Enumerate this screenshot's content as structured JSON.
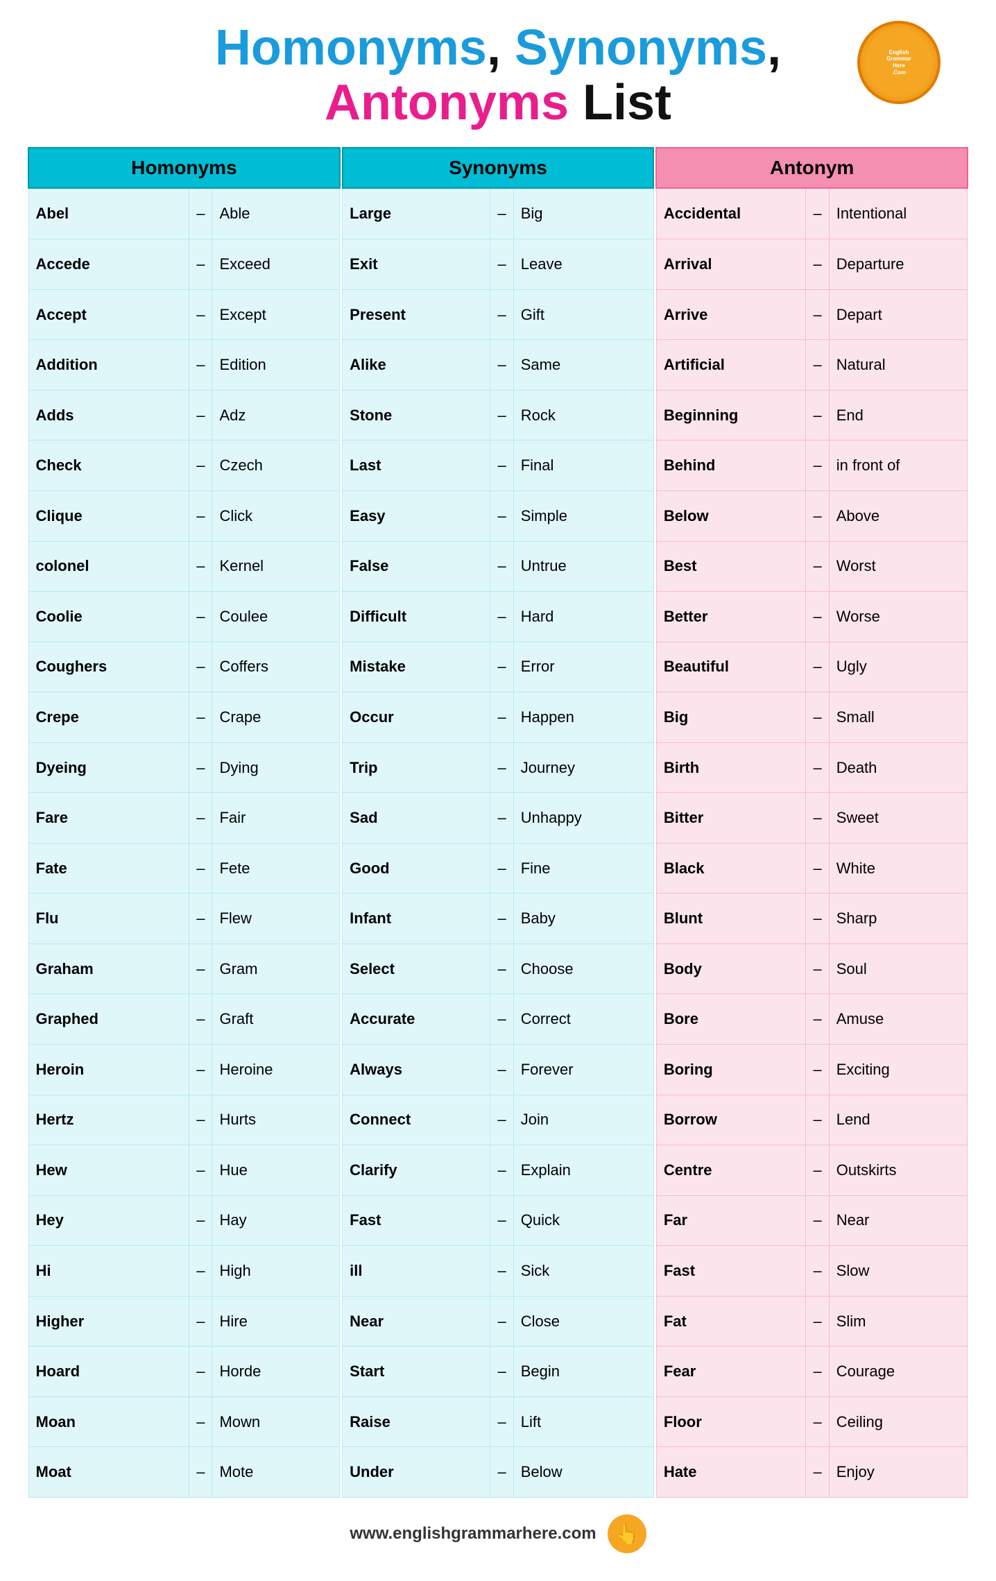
{
  "header": {
    "title_line1": "Homonyms, Synonyms,",
    "title_line2": "Antonyms List"
  },
  "homonyms": {
    "header": "Homonyms",
    "rows": [
      [
        "Abel",
        "Able"
      ],
      [
        "Accede",
        "Exceed"
      ],
      [
        "Accept",
        "Except"
      ],
      [
        "Addition",
        "Edition"
      ],
      [
        "Adds",
        "Adz"
      ],
      [
        "Check",
        "Czech"
      ],
      [
        "Clique",
        "Click"
      ],
      [
        "colonel",
        "Kernel"
      ],
      [
        "Coolie",
        "Coulee"
      ],
      [
        "Coughers",
        "Coffers"
      ],
      [
        "Crepe",
        "Crape"
      ],
      [
        "Dyeing",
        "Dying"
      ],
      [
        "Fare",
        "Fair"
      ],
      [
        "Fate",
        "Fete"
      ],
      [
        "Flu",
        "Flew"
      ],
      [
        "Graham",
        "Gram"
      ],
      [
        "Graphed",
        "Graft"
      ],
      [
        "Heroin",
        "Heroine"
      ],
      [
        "Hertz",
        "Hurts"
      ],
      [
        "Hew",
        "Hue"
      ],
      [
        "Hey",
        "Hay"
      ],
      [
        "Hi",
        "High"
      ],
      [
        "Higher",
        "Hire"
      ],
      [
        "Hoard",
        "Horde"
      ],
      [
        "Moan",
        "Mown"
      ],
      [
        "Moat",
        "Mote"
      ]
    ]
  },
  "synonyms": {
    "header": "Synonyms",
    "rows": [
      [
        "Large",
        "Big"
      ],
      [
        "Exit",
        "Leave"
      ],
      [
        "Present",
        "Gift"
      ],
      [
        "Alike",
        "Same"
      ],
      [
        "Stone",
        "Rock"
      ],
      [
        "Last",
        "Final"
      ],
      [
        "Easy",
        "Simple"
      ],
      [
        "False",
        "Untrue"
      ],
      [
        "Difficult",
        "Hard"
      ],
      [
        "Mistake",
        "Error"
      ],
      [
        "Occur",
        "Happen"
      ],
      [
        "Trip",
        "Journey"
      ],
      [
        "Sad",
        "Unhappy"
      ],
      [
        "Good",
        "Fine"
      ],
      [
        "Infant",
        "Baby"
      ],
      [
        "Select",
        "Choose"
      ],
      [
        "Accurate",
        "Correct"
      ],
      [
        "Always",
        "Forever"
      ],
      [
        "Connect",
        "Join"
      ],
      [
        "Clarify",
        "Explain"
      ],
      [
        "Fast",
        "Quick"
      ],
      [
        "ill",
        "Sick"
      ],
      [
        "Near",
        "Close"
      ],
      [
        "Start",
        "Begin"
      ],
      [
        "Raise",
        "Lift"
      ],
      [
        "Under",
        "Below"
      ]
    ]
  },
  "antonyms": {
    "header": "Antonym",
    "rows": [
      [
        "Accidental",
        "Intentional"
      ],
      [
        "Arrival",
        "Departure"
      ],
      [
        "Arrive",
        "Depart"
      ],
      [
        "Artificial",
        "Natural"
      ],
      [
        "Beginning",
        "End"
      ],
      [
        "Behind",
        "in front of"
      ],
      [
        "Below",
        "Above"
      ],
      [
        "Best",
        "Worst"
      ],
      [
        "Better",
        "Worse"
      ],
      [
        "Beautiful",
        "Ugly"
      ],
      [
        "Big",
        "Small"
      ],
      [
        "Birth",
        "Death"
      ],
      [
        "Bitter",
        "Sweet"
      ],
      [
        "Black",
        "White"
      ],
      [
        "Blunt",
        "Sharp"
      ],
      [
        "Body",
        "Soul"
      ],
      [
        "Bore",
        "Amuse"
      ],
      [
        "Boring",
        "Exciting"
      ],
      [
        "Borrow",
        "Lend"
      ],
      [
        "Centre",
        "Outskirts"
      ],
      [
        "Far",
        "Near"
      ],
      [
        "Fast",
        "Slow"
      ],
      [
        "Fat",
        "Slim"
      ],
      [
        "Fear",
        "Courage"
      ],
      [
        "Floor",
        "Ceiling"
      ],
      [
        "Hate",
        "Enjoy"
      ]
    ]
  },
  "footer": {
    "url": "www.englishgrammarhere.com"
  }
}
